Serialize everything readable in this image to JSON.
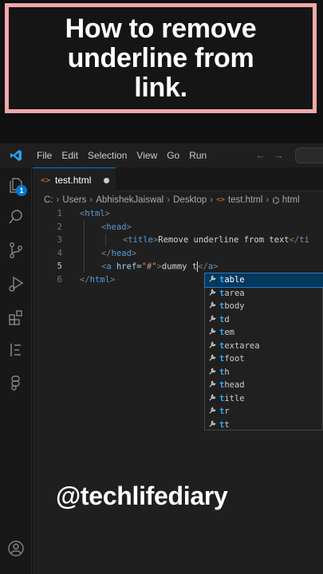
{
  "banner": {
    "title_line1": "How to remove",
    "title_line2": "underline from",
    "title_line3": "link."
  },
  "menubar": {
    "items": [
      "File",
      "Edit",
      "Selection",
      "View",
      "Go",
      "Run"
    ],
    "back_icon": "arrow-left-icon",
    "forward_icon": "arrow-right-icon"
  },
  "activity_bar": {
    "explorer_badge": "1",
    "icons": [
      "files-icon",
      "search-icon",
      "source-control-icon",
      "run-debug-icon",
      "extensions-icon",
      "testing-icon",
      "remote-icon",
      "account-icon"
    ]
  },
  "tab": {
    "filename": "test.html",
    "icon_text": "<>"
  },
  "breadcrumb": {
    "parts": [
      "C:",
      "Users",
      "AbhishekJaiswal",
      "Desktop",
      "test.html",
      "html"
    ],
    "file_icon_text": "<>"
  },
  "code": {
    "lines": [
      {
        "num": "1"
      },
      {
        "num": "2"
      },
      {
        "num": "3"
      },
      {
        "num": "4"
      },
      {
        "num": "5"
      },
      {
        "num": "6"
      }
    ],
    "line1": {
      "open": "<",
      "tag": "html",
      "close": ">"
    },
    "line2": {
      "open": "<",
      "tag": "head",
      "close": ">"
    },
    "line3": {
      "open": "<",
      "tag": "title",
      "close": ">",
      "text": "Remove underline from text",
      "close_open": "</",
      "close_tag": "ti"
    },
    "line4": {
      "open": "</",
      "tag": "head",
      "close": ">"
    },
    "line5": {
      "open": "<",
      "tag": "a",
      "attr": " href",
      "eq": "=",
      "value": "\"#\"",
      "close": ">",
      "text": "dummy t",
      "close_open": "</",
      "close_tag": "a",
      "close_close": ">"
    },
    "line6": {
      "open": "</",
      "tag": "html",
      "close": ">"
    }
  },
  "suggest": {
    "prefix": "t",
    "items": [
      "table",
      "tarea",
      "tbody",
      "td",
      "tem",
      "textarea",
      "tfoot",
      "th",
      "thead",
      "title",
      "tr",
      "tt"
    ],
    "selected_index": 0,
    "icon": "wrench-icon"
  },
  "overlay_handle": "@techlifediary",
  "colors": {
    "accent": "#0078d4",
    "banner_border": "#f0a8aa",
    "tag": "#569cd6",
    "attr": "#9cdcfe",
    "string": "#ce9178",
    "match": "#2aaaff"
  }
}
